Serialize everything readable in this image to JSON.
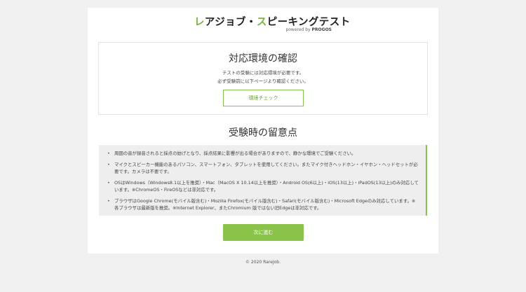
{
  "logo": {
    "title_accent1": "レ",
    "title_part1": "アジョブ・",
    "title_accent2": "ス",
    "title_part2": "ピーキングテスト",
    "powered_prefix": "powered by ",
    "powered_brand": "PROGOS"
  },
  "environment": {
    "title": "対応環境の確認",
    "line1": "テストの受験には対応環境が必要です。",
    "line2": "必ず受験前に以下ページより確認ください。",
    "check_button": "環境チェック"
  },
  "notes": {
    "title": "受験時の留意点",
    "items": [
      "周囲の音が録音されると採点の妨げとなり、採点結果に影響が出る場合がありますので、静かな環境でご受験ください。",
      "マイクとスピーカー機能のあるパソコン、スマートフォン、タブレットを使用してください。またマイク付きヘッドホン・イヤホン・ヘッドセットが必要です。カメラは不要です。",
      "OSはWindows（Windows8.1以上を推奨）・Mac（MacOS X 10.14以上を推奨）・Android OS(6以上)・iOS(13以上)・iPadOS(13以上)のみ対応しています。※ChromeOS・FireOSなどは非対応です。",
      "ブラウザはGoogle Chrome(モバイル版含む)・Mozilla Firefox(モバイル版含む)・Safari(モバイル版含む)・Microsoft Edgeのみ対応しています。※各ブラウザは最新版を推奨。※Internet Explorer、またChromium 版ではない旧Edgeは非対応です。"
    ]
  },
  "next_button": "次に進む",
  "footer": "© 2020 RareJob.",
  "colors": {
    "accent": "#8bc34a",
    "background": "#f0f0f0",
    "card": "#ffffff"
  }
}
